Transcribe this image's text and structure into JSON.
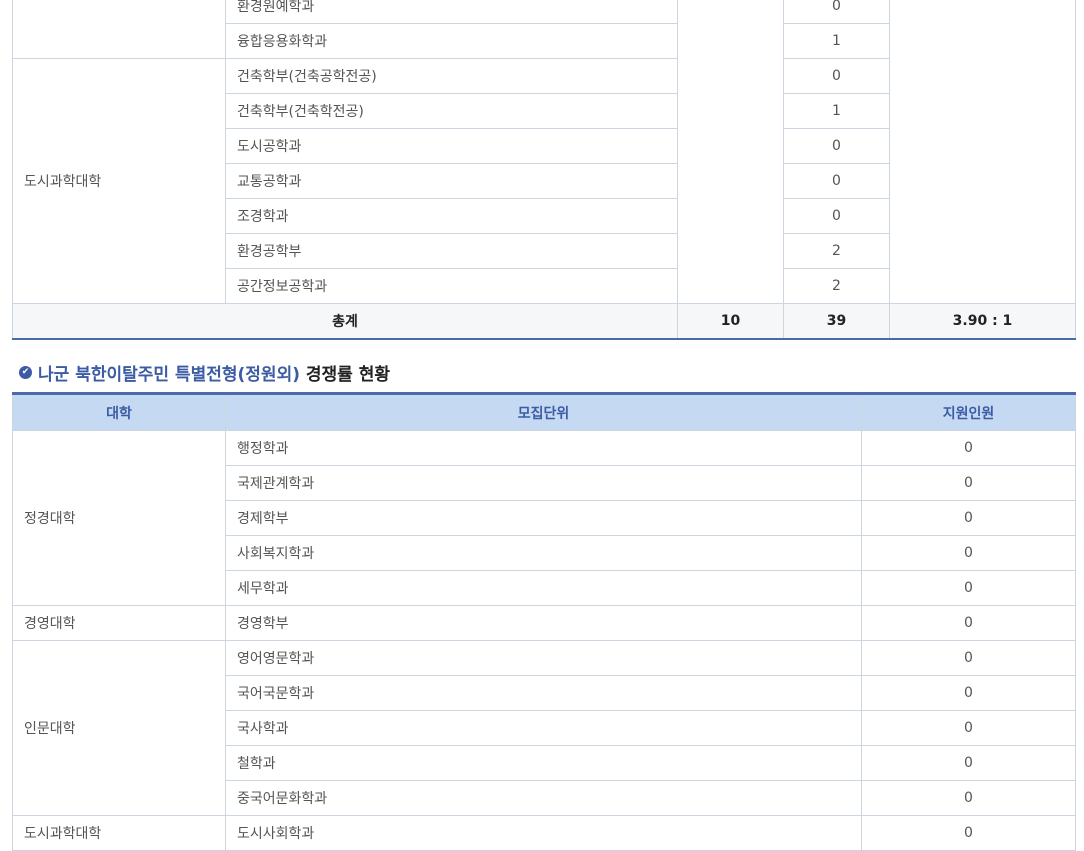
{
  "table1": {
    "rows_prev": [
      {
        "dept": "환경원예학과",
        "applicants": "0"
      },
      {
        "dept": "융합응용화학과",
        "applicants": "1"
      }
    ],
    "urban_group": {
      "college": "도시과학대학",
      "rows": [
        {
          "dept": "건축학부(건축공학전공)",
          "applicants": "0"
        },
        {
          "dept": "건축학부(건축학전공)",
          "applicants": "1"
        },
        {
          "dept": "도시공학과",
          "applicants": "0"
        },
        {
          "dept": "교통공학과",
          "applicants": "0"
        },
        {
          "dept": "조경학과",
          "applicants": "0"
        },
        {
          "dept": "환경공학부",
          "applicants": "2"
        },
        {
          "dept": "공간정보공학과",
          "applicants": "2"
        }
      ]
    },
    "total": {
      "label": "총계",
      "quota": "10",
      "applicants": "39",
      "ratio": "3.90 : 1"
    }
  },
  "section2": {
    "heading_highlight": "나군 북한이탈주민 특별전형(정원외)",
    "heading_rest": " 경쟁률 현황",
    "headers": {
      "college": "대학",
      "unit": "모집단위",
      "applicants": "지원인원"
    },
    "groups": [
      {
        "college": "정경대학",
        "rows": [
          {
            "dept": "행정학과",
            "applicants": "0"
          },
          {
            "dept": "국제관계학과",
            "applicants": "0"
          },
          {
            "dept": "경제학부",
            "applicants": "0"
          },
          {
            "dept": "사회복지학과",
            "applicants": "0"
          },
          {
            "dept": "세무학과",
            "applicants": "0"
          }
        ]
      },
      {
        "college": "경영대학",
        "rows": [
          {
            "dept": "경영학부",
            "applicants": "0"
          }
        ]
      },
      {
        "college": "인문대학",
        "rows": [
          {
            "dept": "영어영문학과",
            "applicants": "0"
          },
          {
            "dept": "국어국문학과",
            "applicants": "0"
          },
          {
            "dept": "국사학과",
            "applicants": "0"
          },
          {
            "dept": "철학과",
            "applicants": "0"
          },
          {
            "dept": "중국어문화학과",
            "applicants": "0"
          }
        ]
      },
      {
        "college": "도시과학대학",
        "rows": [
          {
            "dept": "도시사회학과",
            "applicants": "0"
          }
        ]
      }
    ]
  }
}
